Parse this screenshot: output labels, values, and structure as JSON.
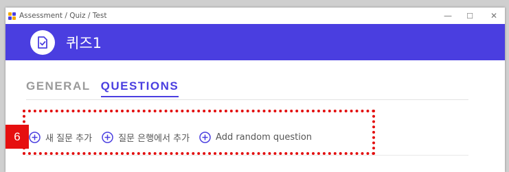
{
  "window": {
    "title": "Assessment / Quiz / Test",
    "controls": {
      "minimize": "—",
      "maximize": "☐",
      "close": "✕"
    }
  },
  "header": {
    "icon": "quiz-doc-check-icon",
    "title": "퀴즈1",
    "bg_color": "#4a3ee0"
  },
  "tabs": [
    {
      "label": "GENERAL",
      "active": false
    },
    {
      "label": "QUESTIONS",
      "active": true
    }
  ],
  "annotation": {
    "number": "6",
    "color": "#e30d0d"
  },
  "actions": [
    {
      "icon": "plus-circle-icon",
      "label": "새 질문 추가"
    },
    {
      "icon": "plus-circle-icon",
      "label": "질문 은행에서 추가"
    },
    {
      "icon": "plus-circle-icon",
      "label": "Add random question"
    }
  ]
}
